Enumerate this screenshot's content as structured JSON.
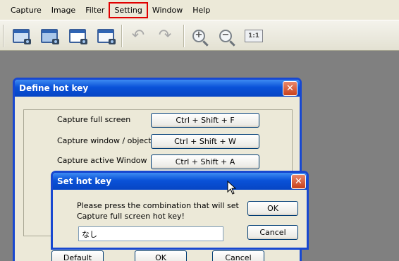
{
  "menu": {
    "items": [
      {
        "label": "Capture"
      },
      {
        "label": "Image"
      },
      {
        "label": "Filter"
      },
      {
        "label": "Setting"
      },
      {
        "label": "Window"
      },
      {
        "label": "Help"
      }
    ],
    "highlighted_item": "Setting",
    "highlight_color": "#e00000"
  },
  "toolbar": {
    "zoom_in_glyph": "+",
    "zoom_out_glyph": "−",
    "ratio_label": "1:1",
    "undo_glyph": "↶",
    "redo_glyph": "↷"
  },
  "define_dialog": {
    "title": "Define hot key",
    "close_glyph": "✕",
    "rows": [
      {
        "label": "Capture full screen",
        "key": "Ctrl + Shift + F"
      },
      {
        "label": "Capture window / object",
        "key": "Ctrl + Shift + W"
      },
      {
        "label": "Capture active Window",
        "key": "Ctrl + Shift + A"
      }
    ],
    "default_label": "Default",
    "ok_label": "OK",
    "cancel_label": "Cancel"
  },
  "set_dialog": {
    "title": "Set hot key",
    "close_glyph": "✕",
    "message_line1": "Please press the combination that will set",
    "message_line2": "Capture full screen hot key!",
    "input_value": "なし",
    "ok_label": "OK",
    "cancel_label": "Cancel"
  },
  "colors": {
    "titlebar_blue": "#0a52d8",
    "background_gray": "#808080"
  }
}
